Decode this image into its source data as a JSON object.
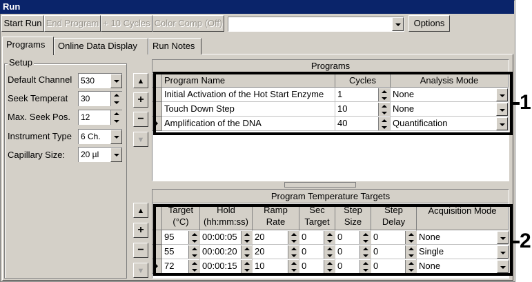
{
  "window": {
    "title": "Run"
  },
  "toolbar": {
    "start_run": "Start Run",
    "end_program": "End Program",
    "plus10": "+ 10 Cycles",
    "color_comp": "Color Comp (Off)",
    "options": "Options",
    "combo_value": ""
  },
  "tabs": [
    {
      "label": "Programs",
      "active": true
    },
    {
      "label": "Online Data Display",
      "active": false
    },
    {
      "label": "Run Notes",
      "active": false
    }
  ],
  "setup": {
    "title": "Setup",
    "fields": [
      {
        "label": "Default Channel",
        "value": "530",
        "control": "dropdown"
      },
      {
        "label": "Seek Temperat",
        "value": "30",
        "control": "spin"
      },
      {
        "label": "Max. Seek Pos.",
        "value": "12",
        "control": "spin"
      },
      {
        "label": "Instrument Type",
        "value": "6 Ch.",
        "control": "dropdown"
      },
      {
        "label": "Capillary Size:",
        "value": "20 µl",
        "control": "dropdown"
      }
    ]
  },
  "programs": {
    "title": "Programs",
    "columns": [
      "Program Name",
      "Cycles",
      "Analysis Mode"
    ],
    "rows": [
      {
        "name": "Initial Activation of the Hot Start Enzyme",
        "cycles": "1",
        "mode": "None",
        "current": false
      },
      {
        "name": "Touch Down Step",
        "cycles": "10",
        "mode": "None",
        "current": false
      },
      {
        "name": "Amplification of the DNA",
        "cycles": "40",
        "mode": "Quantification",
        "current": true
      }
    ],
    "callout": "1"
  },
  "targets": {
    "title": "Program Temperature Targets",
    "columns": [
      {
        "l1": "Target",
        "l2": "(°C)"
      },
      {
        "l1": "Hold",
        "l2": "(hh:mm:ss)"
      },
      {
        "l1": "Ramp",
        "l2": "Rate"
      },
      {
        "l1": "Sec",
        "l2": "Target"
      },
      {
        "l1": "Step",
        "l2": "Size"
      },
      {
        "l1": "Step",
        "l2": "Delay"
      },
      {
        "l1": "Acquisition Mode",
        "l2": ""
      }
    ],
    "rows": [
      {
        "target": "95",
        "hold": "00:00:05",
        "ramp": "20",
        "sec": "0",
        "size": "0",
        "delay": "0",
        "acq": "None",
        "current": false
      },
      {
        "target": "55",
        "hold": "00:00:20",
        "ramp": "20",
        "sec": "0",
        "size": "0",
        "delay": "0",
        "acq": "Single",
        "current": false
      },
      {
        "target": "72",
        "hold": "00:00:15",
        "ramp": "10",
        "sec": "0",
        "size": "0",
        "delay": "0",
        "acq": "None",
        "current": true
      }
    ],
    "callout": "2"
  },
  "side_buttons": {
    "up": "▲",
    "add": "+",
    "remove": "−",
    "down": "▼"
  },
  "icons": [
    "up-arrow-icon",
    "plus-icon",
    "minus-icon",
    "down-arrow-icon",
    "dropdown-arrow-icon",
    "spin-icon",
    "row-pointer-icon"
  ]
}
